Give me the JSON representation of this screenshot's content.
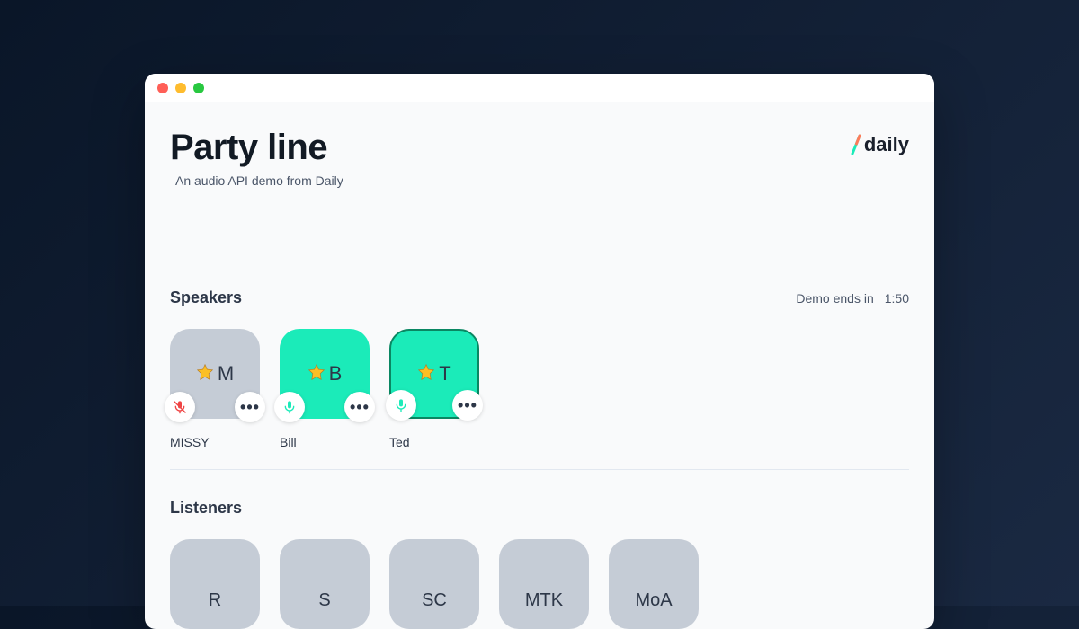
{
  "header": {
    "title": "Party line",
    "subtitle": "An audio API demo from Daily",
    "logo_text": "daily"
  },
  "timer": {
    "label": "Demo ends in",
    "value": "1:50"
  },
  "speakers": {
    "title": "Speakers",
    "items": [
      {
        "initial": "M",
        "name": "MISSY",
        "muted": true,
        "starred": true,
        "active_border": false
      },
      {
        "initial": "B",
        "name": "Bill",
        "muted": false,
        "starred": true,
        "active_border": false
      },
      {
        "initial": "T",
        "name": "Ted",
        "muted": false,
        "starred": true,
        "active_border": true
      }
    ]
  },
  "listeners": {
    "title": "Listeners",
    "items": [
      {
        "initial": "R"
      },
      {
        "initial": "S"
      },
      {
        "initial": "SC"
      },
      {
        "initial": "MTK"
      },
      {
        "initial": "MoA"
      }
    ]
  },
  "colors": {
    "active_tile": "#1bebb9",
    "muted_tile": "#c5ccd6",
    "star_fill": "#fbbf24",
    "mic_active": "#1bebb9",
    "mic_muted": "#ef4444"
  }
}
